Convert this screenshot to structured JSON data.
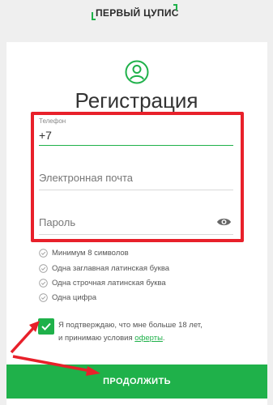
{
  "header": {
    "logo_text": "ПЕРВЫЙ ЦУПИС"
  },
  "form": {
    "title": "Регистрация",
    "phone_label": "Телефон",
    "phone_value": "+7",
    "email_placeholder": "Электронная почта",
    "password_placeholder": "Пароль"
  },
  "requirements": [
    "Минимум 8 символов",
    "Одна заглавная латинская буква",
    "Одна строчная латинская буква",
    "Одна цифра"
  ],
  "consent": {
    "line1": "Я подтверждаю, что мне больше 18 лет,",
    "line2_prefix": "и принимаю условия ",
    "offer_link": "оферты",
    "line2_suffix": ".",
    "checked": true
  },
  "submit_label": "ПРОДОЛЖИТЬ",
  "colors": {
    "accent": "#1fb14a",
    "highlight": "#e8202a"
  },
  "icons": [
    "user-icon",
    "eye-icon",
    "check-icon"
  ]
}
